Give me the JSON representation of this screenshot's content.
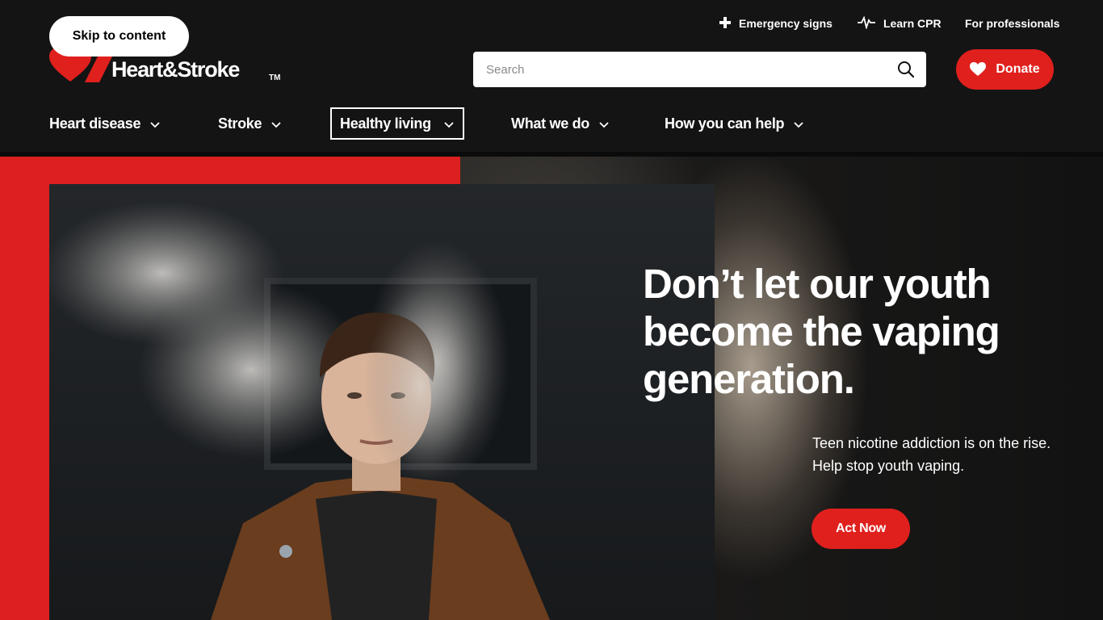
{
  "header": {
    "skip_label": "Skip to content",
    "logo_text": "Heart&Stroke",
    "logo_tm": "TM",
    "utility_links": [
      {
        "label": "Emergency signs",
        "icon": "plus-cross-icon"
      },
      {
        "label": "Learn CPR",
        "icon": "heartbeat-icon"
      },
      {
        "label": "For professionals"
      }
    ],
    "search": {
      "placeholder": "Search",
      "value": "",
      "icon": "search-icon"
    },
    "donate_label": "Donate",
    "donate_icon": "heart-icon"
  },
  "nav": {
    "items": [
      {
        "label": "Heart disease",
        "active": false
      },
      {
        "label": "Stroke",
        "active": false
      },
      {
        "label": "Healthy living",
        "active": true
      },
      {
        "label": "What we do",
        "active": false
      },
      {
        "label": "How you can help",
        "active": false
      }
    ]
  },
  "hero": {
    "headline": "Don’t let our youth become the vaping generation.",
    "subtext_line1": "Teen nicotine addiction is on the rise.",
    "subtext_line2": "Help stop youth vaping.",
    "cta_label": "Act Now"
  },
  "colors": {
    "brand_red": "#e0201d",
    "header_bg": "#141414",
    "white": "#ffffff"
  }
}
